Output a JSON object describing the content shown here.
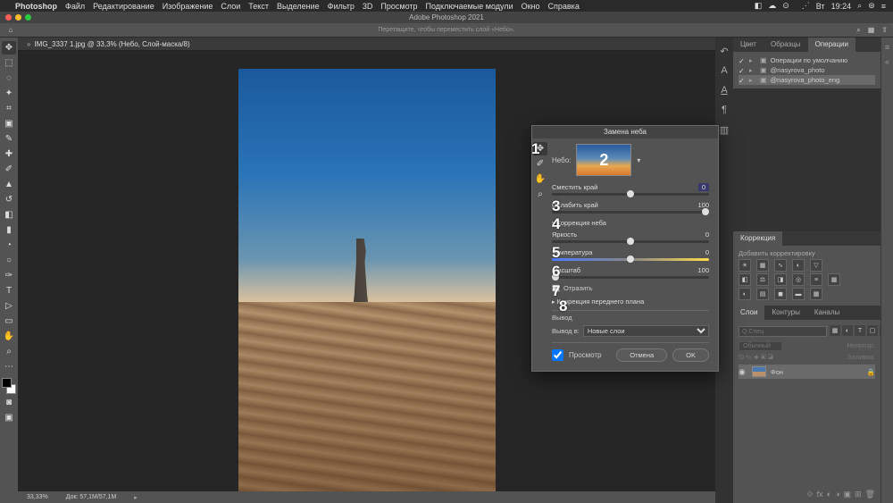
{
  "menubar": {
    "apple": "",
    "items": [
      "Photoshop",
      "Файл",
      "Редактирование",
      "Изображение",
      "Слои",
      "Текст",
      "Выделение",
      "Фильтр",
      "3D",
      "Просмотр",
      "Подключаемые модули",
      "Окно",
      "Справка"
    ],
    "right": {
      "lang": "",
      "day": "Вт",
      "time": "19:24"
    }
  },
  "window": {
    "title": "Adobe Photoshop 2021"
  },
  "options": {
    "hint": "Перетащите, чтобы переместить слой «Небо»."
  },
  "doc": {
    "tab": "IMG_3337 1.jpg @ 33,3% (Небо, Слой-маска/8)",
    "zoom": "33,33%",
    "docinfo": "Док: 57,1M/57,1M"
  },
  "dialog": {
    "title": "Замена неба",
    "sky_label": "Небо:",
    "sliders": {
      "shift": {
        "label": "Сместить край",
        "val": "0"
      },
      "fade": {
        "label": "Ослабить край",
        "val": "100"
      },
      "bright": {
        "label": "Яркость",
        "val": "0"
      },
      "temp": {
        "label": "Температура",
        "val": "0"
      },
      "scale": {
        "label": "Масштаб",
        "val": "100"
      }
    },
    "sec_sky": "Коррекция неба",
    "flip": "Отразить",
    "sec_fg": "Коррекция переднего плана",
    "out_head": "Вывод",
    "out_label": "Вывод в:",
    "out_value": "Новые слои",
    "preview": "Просмотр",
    "cancel": "Отмена",
    "ok": "OK",
    "annot": {
      "n1": "1",
      "n2": "2",
      "n3": "3",
      "n4": "4",
      "n5": "5",
      "n6": "6",
      "n7": "7",
      "n8": "8"
    }
  },
  "panels": {
    "color_tabs": [
      "Цвет",
      "Образцы",
      "Операции"
    ],
    "actions": [
      {
        "name": "Операции по умолчанию"
      },
      {
        "name": "@nasyrova_photo"
      },
      {
        "name": "@nasyrova_photo_eng"
      }
    ],
    "adjust_tab": "Коррекция",
    "adjust_hint": "Добавить корректировку",
    "layers_tabs": [
      "Слои",
      "Контуры",
      "Каналы"
    ],
    "search_ph": "Q Спец",
    "opacity_lbl": "Обычный",
    "blend_lbl": "Непрозр.",
    "fill_lbl": "Заливка:",
    "layer": "Фон"
  }
}
